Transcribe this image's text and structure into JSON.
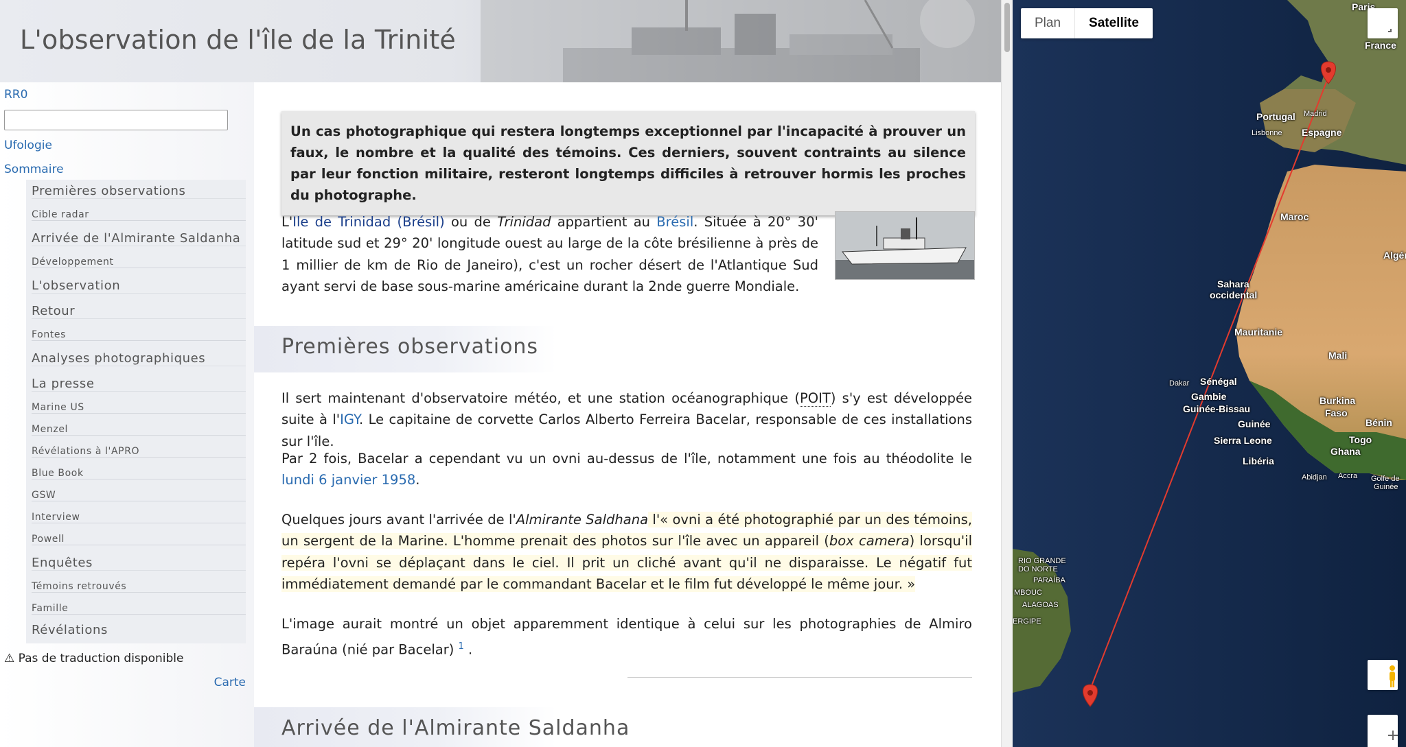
{
  "page": {
    "title": "L'observation de l'île de la Trinité"
  },
  "sidebar": {
    "rr0_label": "RR0",
    "search_value": "",
    "ufologie_label": "Ufologie",
    "sommaire_label": "Sommaire",
    "toc": [
      {
        "label": "Premières observations",
        "level": 1
      },
      {
        "label": "Cible radar",
        "level": 2
      },
      {
        "label": "Arrivée de l'Almirante Saldanha",
        "level": 1
      },
      {
        "label": "Développement",
        "level": 2
      },
      {
        "label": "L'observation",
        "level": 1
      },
      {
        "label": "Retour",
        "level": 1
      },
      {
        "label": "Fontes",
        "level": 2
      },
      {
        "label": "Analyses photographiques",
        "level": 1
      },
      {
        "label": "La presse",
        "level": 1
      },
      {
        "label": "Marine US",
        "level": 2
      },
      {
        "label": "Menzel",
        "level": 2
      },
      {
        "label": "Révélations à l'APRO",
        "level": 2
      },
      {
        "label": "Blue Book",
        "level": 2
      },
      {
        "label": "GSW",
        "level": 2
      },
      {
        "label": "Interview",
        "level": 2
      },
      {
        "label": "Powell",
        "level": 2
      },
      {
        "label": "Enquêtes",
        "level": 1
      },
      {
        "label": "Témoins retrouvés",
        "level": 2
      },
      {
        "label": "Famille",
        "level": 2
      },
      {
        "label": "Révélations",
        "level": 1
      }
    ],
    "translation_note": "⚠ Pas de traduction disponible",
    "carte_label": "Carte"
  },
  "content": {
    "intro": "Un cas photographique qui restera longtemps exceptionnel par l'incapacité à prouver un faux, le nombre et la qualité des témoins. Ces derniers, souvent contraints au silence par leur fonction militaire, resteront longtemps difficiles à retrouver hormis les proches du photographe.",
    "p1": {
      "link_island": "Ile de Trinidad (Brésil)",
      "t1": "L'",
      "t2": " ou de ",
      "t2_em": "Trinidad",
      "t3": " appartient au ",
      "link_bresil": "Brésil",
      "t4": ". Située à 20° 30' latitude sud et 29° 20' longitude ouest au large de la côte brésilienne à près de 1 millier de km de Rio de Janeiro), c'est un rocher désert de l'Atlantique Sud ayant servi de base sous-marine américaine durant la 2nde guerre Mondiale."
    },
    "section1_title": "Premières observations",
    "p2": {
      "t1": "Il sert maintenant d'observatoire météo, et une station océanographique (",
      "abbr": "POIT",
      "t2": ") s'y est développée suite à l'",
      "link_igy": "IGY",
      "t3": ". Le capitaine de corvette Carlos Alberto Ferreira Bacelar, responsable de ces installations sur l'île."
    },
    "p3": {
      "t1": "Par 2 fois, Bacelar a cependant vu un ovni au-dessus de l'île, notamment une fois au théodolite le ",
      "link_date": "lundi 6 janvier 1958",
      "t2": "."
    },
    "p4": {
      "t1": "Quelques jours avant l'arrivée de l'",
      "em1": "Almirante Saldhana",
      "t2": " l'« ovni a été photographié par un des témoins, un sergent de la Marine. L'homme prenait des photos sur l'île avec un appareil (",
      "em2": "box camera",
      "t3": ") lorsqu'il repéra l'ovni se déplaçant dans le ciel. Il prit un cliché avant qu'il ne disparaisse. Le négatif fut immédiatement demandé par le commandant Bacelar et le film fut développé le même jour. »"
    },
    "p5": {
      "t1": "L'image aurait montré un objet apparemment identique à celui sur les photographies de Almiro Baraúna (nié par Bacelar) ",
      "ref": "1",
      "t2": "."
    },
    "section2_title": "Arrivée de l'Almirante Saldanha"
  },
  "map": {
    "type_plan": "Plan",
    "type_satellite": "Satellite",
    "active_type": "Satellite",
    "labels": {
      "paris": "Paris",
      "france": "France",
      "portugal": "Portugal",
      "madrid": "Madrid",
      "lisbonne": "Lisbonne",
      "espagne": "Espagne",
      "maroc": "Maroc",
      "algerie": "Algérie",
      "sahara": "Sahara",
      "occidental": "occidental",
      "mauritanie": "Mauritanie",
      "mali": "Mali",
      "dakar": "Dakar",
      "senegal": "Sénégal",
      "gambie": "Gambie",
      "guinee_bissau": "Guinée-Bissau",
      "guinee": "Guinée",
      "burkina": "Burkina",
      "faso": "Faso",
      "benin": "Bénin",
      "togo": "Togo",
      "ghana": "Ghana",
      "sierra_leone": "Sierra Leone",
      "liberia": "Libéria",
      "abidjan": "Abidjan",
      "accra": "Accra",
      "golfe1": "Golfe de",
      "golfe2": "Guinée",
      "rio_grande": "RIO GRANDE",
      "do_norte": "DO NORTE",
      "paraiba": "PARAÍBA",
      "alagoas": "ALAGOAS",
      "mbouc": "MBOUC",
      "ergipe": "ERGIPE"
    },
    "accent_color": "#e33b2e"
  }
}
